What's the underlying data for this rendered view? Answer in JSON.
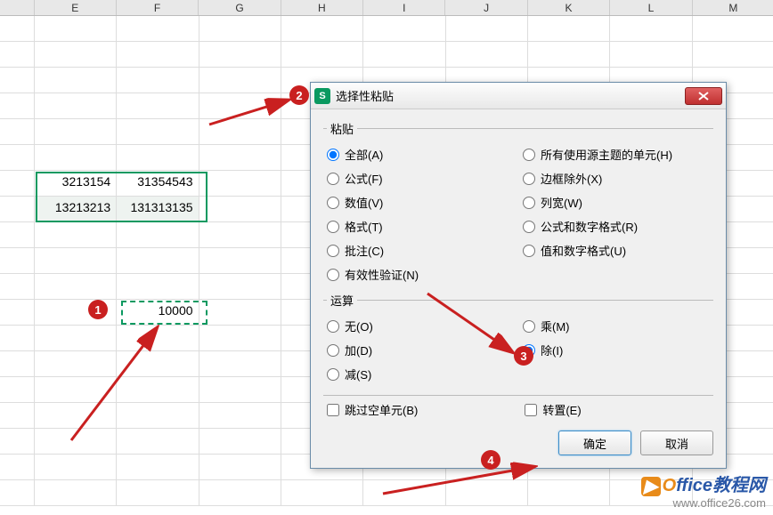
{
  "columns": [
    "E",
    "F",
    "G",
    "H",
    "I",
    "J",
    "K",
    "L",
    "M"
  ],
  "cells": {
    "E7": "3213154",
    "F7": "31354543",
    "E8": "13213213",
    "F8": "131313135",
    "F12": "10000"
  },
  "dialog": {
    "title": "选择性粘贴",
    "paste_legend": "粘贴",
    "op_legend": "运算",
    "paste_opts": {
      "all": "全部(A)",
      "formula": "公式(F)",
      "value": "数值(V)",
      "format": "格式(T)",
      "comment": "批注(C)",
      "validation": "有效性验证(N)",
      "theme": "所有使用源主题的单元(H)",
      "noborder": "边框除外(X)",
      "colwidth": "列宽(W)",
      "fmlnum": "公式和数字格式(R)",
      "valnum": "值和数字格式(U)"
    },
    "op_opts": {
      "none": "无(O)",
      "add": "加(D)",
      "sub": "减(S)",
      "mul": "乘(M)",
      "div": "除(I)"
    },
    "skip": "跳过空单元(B)",
    "transpose": "转置(E)",
    "ok": "确定",
    "cancel": "取消"
  },
  "badges": {
    "b1": "1",
    "b2": "2",
    "b3": "3",
    "b4": "4"
  },
  "watermark": {
    "brand": "Office教程网",
    "url": "www.office26.com"
  }
}
